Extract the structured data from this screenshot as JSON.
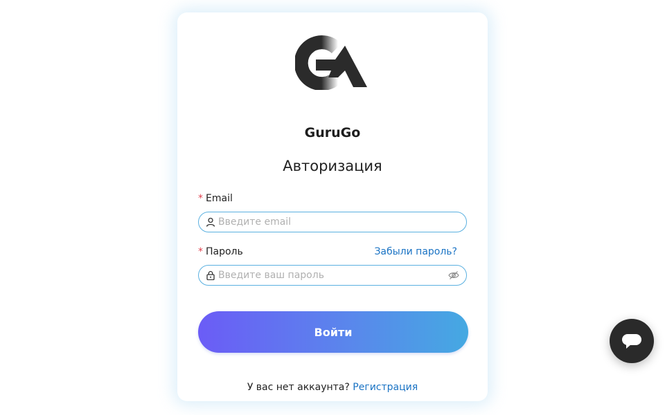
{
  "brand": {
    "name": "GuruGo",
    "logo_icon": "gurugo-logo-icon"
  },
  "form": {
    "heading": "Авторизация",
    "required_marker": "*",
    "email": {
      "label": "Email",
      "placeholder": "Введите email",
      "value": "",
      "icon": "user-icon"
    },
    "password": {
      "label": "Пароль",
      "placeholder": "Введите ваш пароль",
      "value": "",
      "icon": "lock-icon",
      "toggle_icon": "eye-off-icon",
      "forgot_label": "Забыли пароль?"
    },
    "submit_label": "Войти",
    "signup_prompt": "У вас нет аккаунта?",
    "signup_link": "Регистрация"
  },
  "chat_widget": {
    "icon": "chat-bubble-icon"
  },
  "colors": {
    "accent_link": "#1a73c4",
    "input_border": "#5ab0e0",
    "required": "#e0424f",
    "button_gradient_start": "#6b5cf6",
    "button_gradient_end": "#45a9e2",
    "chat_bg": "#2a2a2a"
  }
}
